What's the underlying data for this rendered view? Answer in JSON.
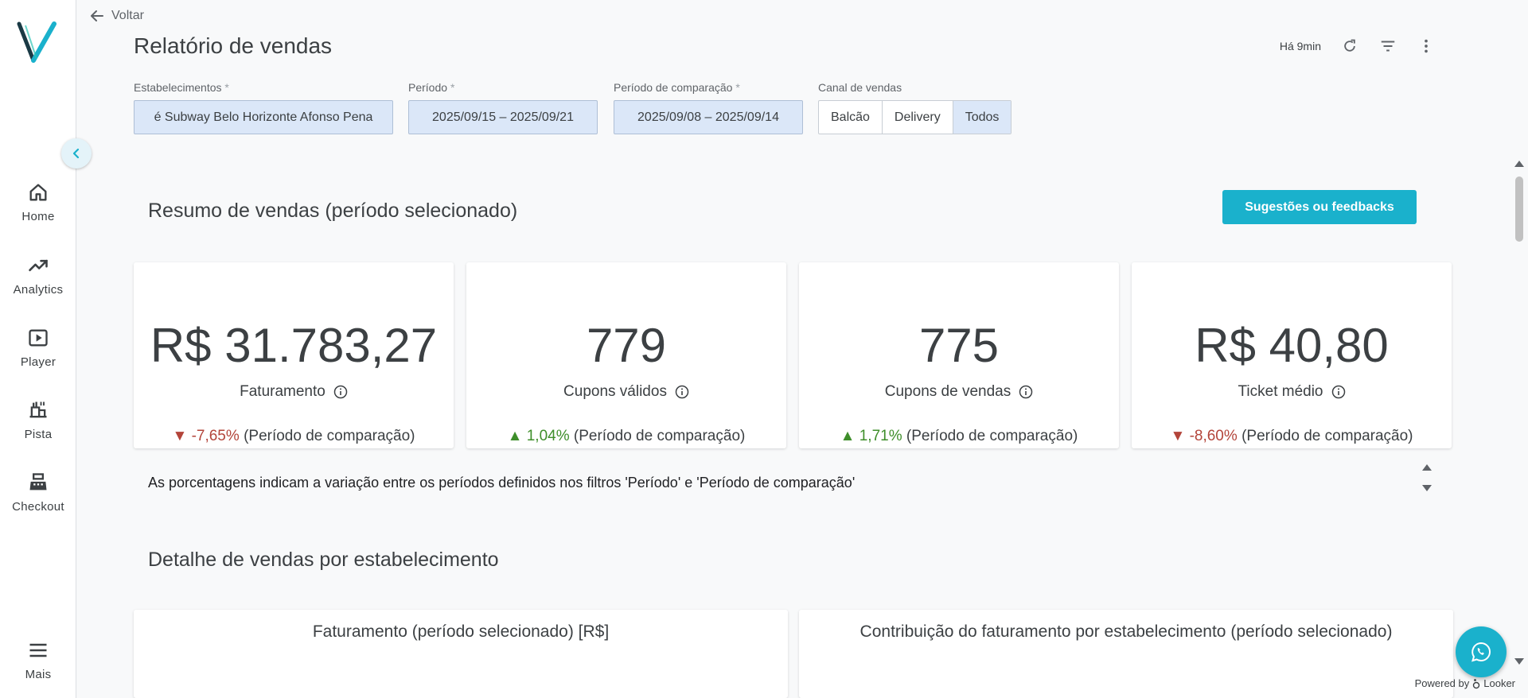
{
  "sidebar": {
    "items": [
      {
        "label": "Home",
        "icon": "home-icon"
      },
      {
        "label": "Analytics",
        "icon": "trending-up-icon"
      },
      {
        "label": "Player",
        "icon": "play-icon"
      },
      {
        "label": "Pista",
        "icon": "kitchen-order-icon"
      },
      {
        "label": "Checkout",
        "icon": "cash-register-icon"
      },
      {
        "label": "Mais",
        "icon": "menu-icon"
      }
    ]
  },
  "header": {
    "back_label": "Voltar",
    "title": "Relatório de vendas",
    "updated": "Há 9min"
  },
  "filters": {
    "establishments": {
      "label": "Estabelecimentos",
      "required": "*",
      "value": "é Subway Belo Horizonte Afonso Pena"
    },
    "period": {
      "label": "Período",
      "required": "*",
      "value": "2025/09/15 – 2025/09/21"
    },
    "comparison": {
      "label": "Período de comparação",
      "required": "*",
      "value": "2025/09/08 – 2025/09/14"
    },
    "channel": {
      "label": "Canal de vendas",
      "options": [
        "Balcão",
        "Delivery",
        "Todos"
      ],
      "selected": "Todos"
    }
  },
  "summary": {
    "title": "Resumo de vendas (período selecionado)",
    "feedback_button": "Sugestões ou feedbacks",
    "kpis": [
      {
        "value": "R$ 31.783,27",
        "label": "Faturamento",
        "change": "▼ -7,65%",
        "direction": "down",
        "suffix": "(Período de comparação)"
      },
      {
        "value": "779",
        "label": "Cupons válidos",
        "change": "▲ 1,04%",
        "direction": "up",
        "suffix": "(Período de comparação)"
      },
      {
        "value": "775",
        "label": "Cupons de vendas",
        "change": "▲ 1,71%",
        "direction": "up",
        "suffix": "(Período de comparação)"
      },
      {
        "value": "R$ 40,80",
        "label": "Ticket médio",
        "change": "▼ -8,60%",
        "direction": "down",
        "suffix": "(Período de comparação)"
      }
    ],
    "note": "As porcentagens indicam a variação entre os períodos definidos nos filtros 'Período' e 'Período de comparação'"
  },
  "detail": {
    "title": "Detalhe de vendas por estabelecimento",
    "cards": [
      {
        "title": "Faturamento (período selecionado) [R$]"
      },
      {
        "title": "Contribuição do faturamento por estabelecimento (período selecionado)"
      }
    ]
  },
  "footer": {
    "powered_by": "Powered by",
    "brand": "Looker"
  },
  "colors": {
    "accent": "#1ab1cc",
    "negative": "#b3443a",
    "positive": "#3e8e2a",
    "chip_bg": "#dbe7f8"
  }
}
